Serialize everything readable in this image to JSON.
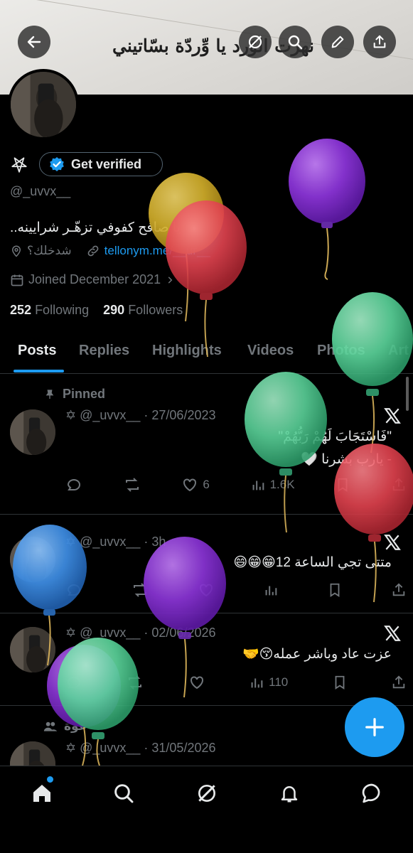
{
  "banner": {
    "text": "نهرت الوّرد يا وِّردّة بسّاتيني"
  },
  "profile": {
    "verify_label": "Get verified",
    "handle": "@_uvvx__",
    "bio": "يا صافح كفوفي تزهّـر شرايينه..",
    "location": "شدخلك؟",
    "website": "tellonym.me/__ur__",
    "joined": "Joined December 2021",
    "following_count": "252",
    "following_label": "Following",
    "followers_count": "290",
    "followers_label": "Followers"
  },
  "tabs": [
    "Posts",
    "Replies",
    "Highlights",
    "Videos",
    "Photos",
    "Art"
  ],
  "posts": [
    {
      "pinned_label": "Pinned",
      "meta": "✡ @_uvvx__ · 27/06/2023",
      "line1": "\"فَاسْتَجَابَ لَهُمْ رَبُّهُمْ\"",
      "line2": "- يارب بشرنا 🤍",
      "likes": "6",
      "views": "1.6K"
    },
    {
      "meta": "✡ @_uvvx__ · 3h",
      "line1": "متتى تجي الساعة 12😁😁😄"
    },
    {
      "meta": "✡ @_uvvx__ · 02/06/2026",
      "line1": "عزت عاد وباشر عمله😚🤝",
      "views": "110"
    },
    {
      "meta": "✡ @_uvvx__ · 31/05/2026",
      "repost_label": "عوة"
    }
  ],
  "colors": {
    "accent": "#1d9bf0",
    "background": "#000000",
    "muted": "#71767b",
    "balloon_purple": "#8a34d6",
    "balloon_yellow": "#d6b22c",
    "balloon_red": "#e2434f",
    "balloon_green": "#5cd69c",
    "balloon_blue": "#3f8fe6"
  },
  "icons": {
    "back": "arrow-left-icon",
    "grok": "grok-icon",
    "search": "search-icon",
    "edit": "pencil-icon",
    "share": "share-icon",
    "home": "home-icon",
    "notifications": "bell-icon",
    "messages": "chat-icon",
    "compose": "plus-icon"
  }
}
